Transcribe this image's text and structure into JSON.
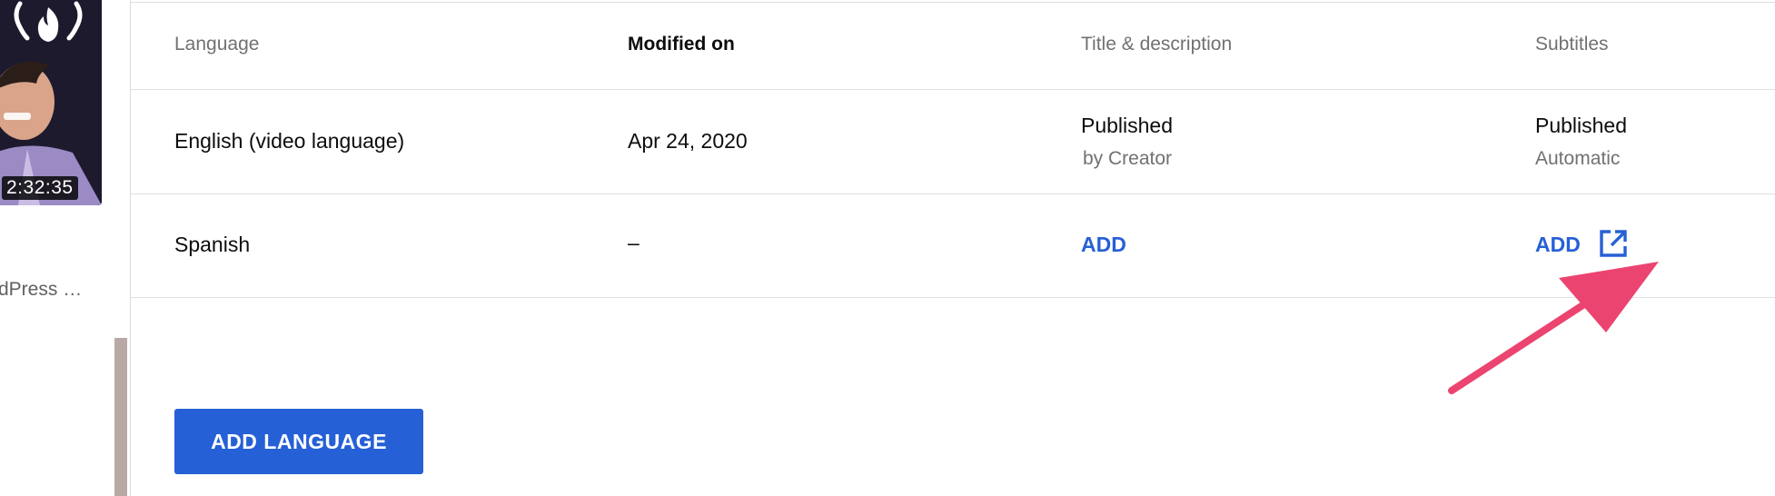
{
  "sidebar": {
    "video_duration": "2:32:35",
    "video_title": "dPress …"
  },
  "table": {
    "headers": {
      "language": "Language",
      "modified_on": "Modified on",
      "title_description": "Title & description",
      "subtitles": "Subtitles"
    },
    "rows": [
      {
        "language": "English (video language)",
        "modified_on": "Apr 24, 2020",
        "title_status": "Published",
        "title_sub": "by Creator",
        "subtitles_status": "Published",
        "subtitles_sub": "Automatic"
      },
      {
        "language": "Spanish",
        "modified_on": "–",
        "title_action": "ADD",
        "subtitles_action": "ADD"
      }
    ]
  },
  "add_language_button": "ADD LANGUAGE",
  "colors": {
    "accent": "#2660d6",
    "annotation_arrow": "#ec4470"
  },
  "icons": [
    "flame-logo-icon",
    "open-in-new-icon",
    "annotation-arrow"
  ]
}
